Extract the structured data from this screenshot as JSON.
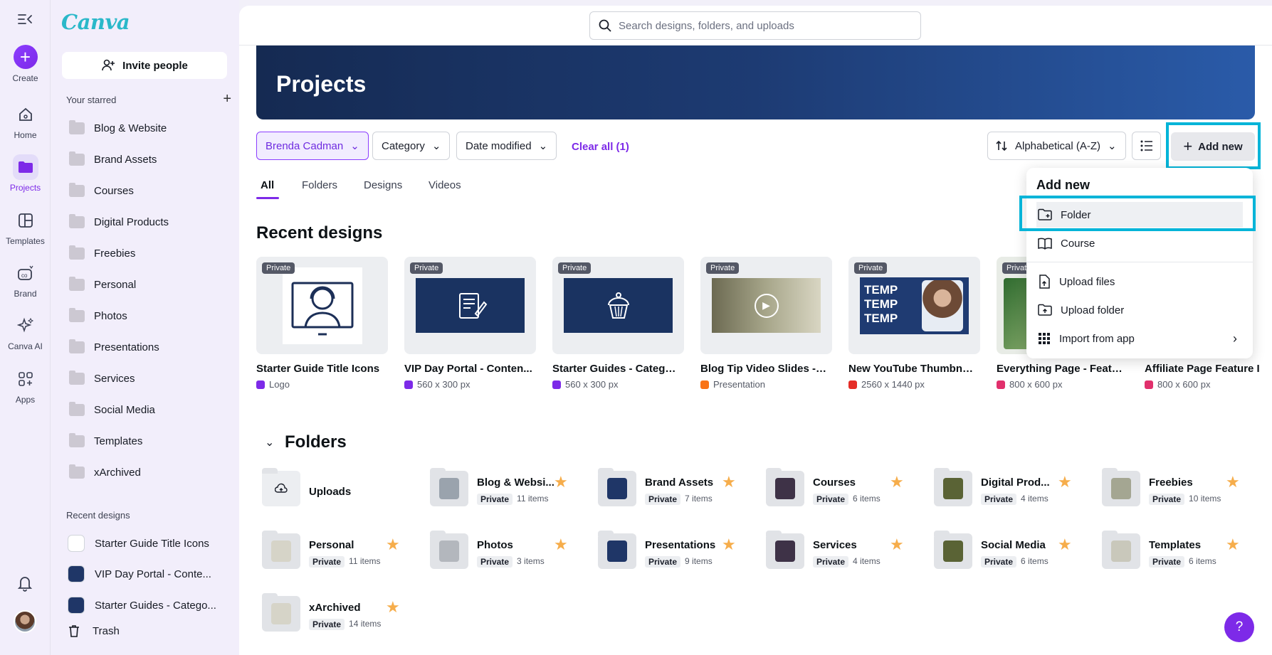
{
  "rail": {
    "create": "Create",
    "items": [
      {
        "label": "Home",
        "icon": "home-icon"
      },
      {
        "label": "Projects",
        "icon": "folder-icon"
      },
      {
        "label": "Templates",
        "icon": "templates-icon"
      },
      {
        "label": "Brand",
        "icon": "brand-icon"
      },
      {
        "label": "Canva AI",
        "icon": "sparkle-icon"
      },
      {
        "label": "Apps",
        "icon": "apps-icon"
      }
    ]
  },
  "sidebar": {
    "logo": "Canva",
    "invite": "Invite people",
    "starred_title": "Your starred",
    "starred": [
      "Blog & Website",
      "Brand Assets",
      "Courses",
      "Digital Products",
      "Freebies",
      "Personal",
      "Photos",
      "Presentations",
      "Services",
      "Social Media",
      "Templates",
      "xArchived"
    ],
    "recent_title": "Recent designs",
    "recent": [
      "Starter Guide Title Icons",
      "VIP Day Portal - Conte...",
      "Starter Guides - Catego..."
    ],
    "trash": "Trash"
  },
  "search": {
    "placeholder": "Search designs, folders, and uploads"
  },
  "banner": {
    "title": "Projects"
  },
  "filters": {
    "owner": "Brenda Cadman",
    "category": "Category",
    "date": "Date modified",
    "clear": "Clear all (1)",
    "sort": "Alphabetical (A-Z)",
    "add_new": "Add new"
  },
  "tabs": [
    "All",
    "Folders",
    "Designs",
    "Videos"
  ],
  "recent_designs": {
    "title": "Recent designs",
    "badge": "Private",
    "items": [
      {
        "title": "Starter Guide Title Icons",
        "sub": "Logo",
        "color": "#7d2ae8"
      },
      {
        "title": "VIP Day Portal - Conten...",
        "sub": "560 x 300 px",
        "color": "#7d2ae8"
      },
      {
        "title": "Starter Guides - Categor...",
        "sub": "560 x 300 px",
        "color": "#7d2ae8"
      },
      {
        "title": "Blog Tip Video Slides - 2...",
        "sub": "Presentation",
        "color": "#f97316"
      },
      {
        "title": "New YouTube Thumbnai...",
        "sub": "2560 x 1440 px",
        "color": "#e52d27"
      },
      {
        "title": "Everything Page - Featu...",
        "sub": "800 x 600 px",
        "color": "#e1306c"
      },
      {
        "title": "Affiliate Page Feature I",
        "sub": "800 x 600 px",
        "color": "#e1306c"
      }
    ],
    "thumb_text": [
      "TEMP",
      "TEMP",
      "TEMP"
    ]
  },
  "folders": {
    "title": "Folders",
    "private": "Private",
    "uploads": "Uploads",
    "items": [
      {
        "name": "Blog & Websi...",
        "count": "11 items"
      },
      {
        "name": "Brand Assets",
        "count": "7 items"
      },
      {
        "name": "Courses",
        "count": "6 items"
      },
      {
        "name": "Digital Prod...",
        "count": "4 items"
      },
      {
        "name": "Freebies",
        "count": "10 items"
      },
      {
        "name": "Personal",
        "count": "11 items"
      },
      {
        "name": "Photos",
        "count": "3 items"
      },
      {
        "name": "Presentations",
        "count": "9 items"
      },
      {
        "name": "Services",
        "count": "4 items"
      },
      {
        "name": "Social Media",
        "count": "6 items"
      },
      {
        "name": "Templates",
        "count": "6 items"
      },
      {
        "name": "xArchived",
        "count": "14 items"
      }
    ]
  },
  "menu": {
    "title": "Add new",
    "items": [
      "Folder",
      "Course",
      "Upload files",
      "Upload folder",
      "Import from app"
    ]
  },
  "help": "?"
}
